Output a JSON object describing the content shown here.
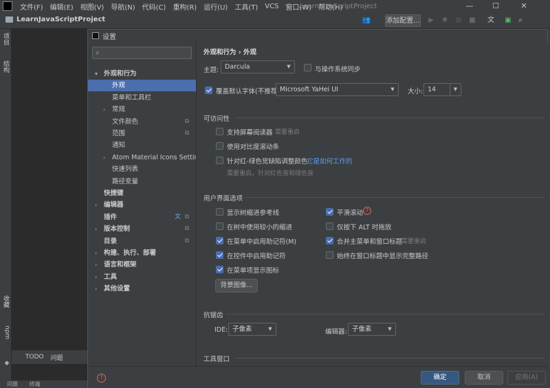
{
  "window": {
    "title": "LearnJavaScriptProject",
    "menu": [
      "文件(F)",
      "编辑(E)",
      "视图(V)",
      "导航(N)",
      "代码(C)",
      "重构(R)",
      "运行(U)",
      "工具(T)",
      "VCS",
      "窗口(W)",
      "帮助(H)"
    ],
    "controls": [
      "—",
      "☐",
      "✕"
    ]
  },
  "toolbar": {
    "project": "LearnJavaScriptProject",
    "add_config": "添加配置..."
  },
  "left_strip": {
    "project": "项目",
    "structure": "结构",
    "bookmarks": "收藏",
    "npm": "npm"
  },
  "bottom_tabs": {
    "todo": "TODO",
    "problems": "问题"
  },
  "status": {
    "problems": "问题",
    "terminal": "终端"
  },
  "dialog": {
    "title": "设置",
    "search_placeholder": "",
    "nav": [
      {
        "label": "外观和行为",
        "level": 0,
        "arrow": "▾",
        "bold": true
      },
      {
        "label": "外观",
        "level": 1,
        "selected": true
      },
      {
        "label": "菜单和工具栏",
        "level": 1
      },
      {
        "label": "常规",
        "level": 1,
        "arrow": "›"
      },
      {
        "label": "文件颜色",
        "level": 1,
        "copy": true
      },
      {
        "label": "范围",
        "level": 1,
        "copy": true
      },
      {
        "label": "通知",
        "level": 1
      },
      {
        "label": "Atom Material Icons Setting",
        "level": 1,
        "arrow": "›"
      },
      {
        "label": "快速列表",
        "level": 1
      },
      {
        "label": "路径变量",
        "level": 1
      },
      {
        "label": "快捷键",
        "level": 0,
        "bold": true
      },
      {
        "label": "编辑器",
        "level": 0,
        "arrow": "›",
        "bold": true
      },
      {
        "label": "插件",
        "level": 0,
        "bold": true,
        "translate": true,
        "copy": true
      },
      {
        "label": "版本控制",
        "level": 0,
        "arrow": "›",
        "bold": true,
        "copy": true
      },
      {
        "label": "目录",
        "level": 0,
        "bold": true,
        "copy": true
      },
      {
        "label": "构建、执行、部署",
        "level": 0,
        "arrow": "›",
        "bold": true
      },
      {
        "label": "语言和框架",
        "level": 0,
        "arrow": "›",
        "bold": true
      },
      {
        "label": "工具",
        "level": 0,
        "arrow": "›",
        "bold": true
      },
      {
        "label": "其他设置",
        "level": 0,
        "arrow": "›",
        "bold": true
      }
    ],
    "breadcrumb": "外观和行为  ›  外观",
    "theme": {
      "label": "主题:",
      "value": "Darcula",
      "sync_label": "与操作系统同步",
      "sync_checked": false
    },
    "font": {
      "override_label": "覆盖默认字体(不推荐):",
      "override_checked": true,
      "value": "Microsoft YaHei UI",
      "size_label": "大小:",
      "size_value": "14"
    },
    "accessibility": {
      "title": "可访问性",
      "screen_reader": "支持屏幕阅读器",
      "screen_reader_note": "需要重启",
      "contrast_scrollbars": "使用对比度滚动条",
      "color_deficiency": "针对红-绿色觉缺陷调整颜色",
      "how_it_works": "它是如何工作的",
      "color_note": "需要重启。针对红色盲和绿色盲"
    },
    "ui_options": {
      "title": "用户界面选项",
      "tree_indent_guides": "显示树缩进参考线",
      "smaller_indents": "在树中使用较小的缩进",
      "menu_mnemonics": "在菜单中启用助记符(M)",
      "control_mnemonics": "在控件中启用助记符",
      "menu_icons": "在菜单项显示图标",
      "background_image": "背景图像...",
      "smooth_scrolling": "平滑滚动",
      "alt_drag": "仅按下 ALT 时拖放",
      "merge_menu_title": "合并主菜单和窗口标题",
      "merge_note": "需要重启",
      "full_path": "始终在窗口标题中显示完整路径"
    },
    "antialiasing": {
      "title": "抗锯齿",
      "ide_label": "IDE:",
      "ide_value": "子像素",
      "editor_label": "编辑器:",
      "editor_value": "子像素"
    },
    "tool_windows_title": "工具窗口",
    "footer": {
      "ok": "确定",
      "cancel": "取消",
      "apply": "应用(A)"
    }
  },
  "colors": {
    "accent": "#4b6eaf",
    "link": "#589df6",
    "background": "#3c3f41"
  }
}
